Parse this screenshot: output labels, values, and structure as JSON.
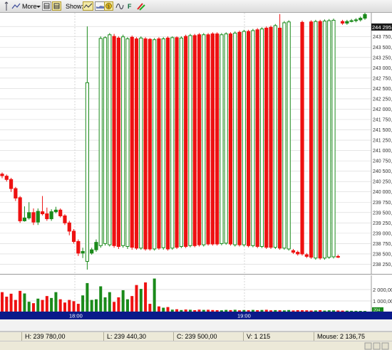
{
  "toolbar": {
    "more_label": "More",
    "show_label": "Show:",
    "f_label": "F",
    "icons": [
      "cursor-icon",
      "line-tool-icon",
      "dropdown-arrow-icon",
      "bar-layout-icon",
      "candle-layout-icon",
      "line-chart-icon",
      "area-chart-icon",
      "indicator-icon",
      "wave-icon",
      "formula-icon",
      "palette-icon"
    ]
  },
  "price_axis": {
    "current_price": "244 295,00",
    "ticks": [
      "244 000,0",
      "243 750,0",
      "243 500,0",
      "243 250,0",
      "243 000,0",
      "242 750,0",
      "242 500,0",
      "242 250,0",
      "242 000,0",
      "241 750,0",
      "241 500,0",
      "241 250,0",
      "241 000,0",
      "240 750,0",
      "240 500,0",
      "240 250,0",
      "240 000,0",
      "239 750,0",
      "239 500,0",
      "239 250,0",
      "239 000,0",
      "238 750,0",
      "238 500,0",
      "238 250,0"
    ],
    "tick_values": [
      244000,
      243750,
      243500,
      243250,
      243000,
      242750,
      242500,
      242250,
      242000,
      241750,
      241500,
      241250,
      241000,
      240750,
      240500,
      240250,
      240000,
      239750,
      239500,
      239250,
      239000,
      238750,
      238500,
      238250
    ]
  },
  "volume_axis": {
    "ticks": [
      "2 000,00",
      "1 000,00"
    ],
    "current_volume": "204"
  },
  "time_axis": {
    "labels": [
      "18:00",
      "19:00"
    ]
  },
  "status": {
    "high": "H: 239 780,00",
    "low": "L: 239 440,30",
    "close": "C: 239 500,00",
    "volume": "V: 1 215",
    "mouse": "Mouse: 2 136,75"
  },
  "colors": {
    "up": "#1a8a1a",
    "down": "#ee1111",
    "background": "#ffffff",
    "grid": "#d6d6d6",
    "axis_band": "#0a1a8a",
    "current_price_bg": "#1a1a1a"
  },
  "chart_data": {
    "type": "candlestick",
    "ylim": [
      238000,
      244330
    ],
    "volume_ylim": [
      0,
      2800
    ],
    "candles": [
      {
        "o": 240430,
        "c": 240390,
        "h": 240470,
        "l": 240330
      },
      {
        "o": 240380,
        "c": 240300,
        "h": 240420,
        "l": 240250
      },
      {
        "o": 240300,
        "c": 240080,
        "h": 240340,
        "l": 240000
      },
      {
        "o": 240080,
        "c": 239850,
        "h": 240120,
        "l": 239780
      },
      {
        "o": 239860,
        "c": 239300,
        "h": 239900,
        "l": 239250
      },
      {
        "o": 239300,
        "c": 239370,
        "h": 239650,
        "l": 239280
      },
      {
        "o": 239370,
        "c": 239500,
        "h": 239750,
        "l": 239330
      },
      {
        "o": 239500,
        "c": 239270,
        "h": 239600,
        "l": 239200
      },
      {
        "o": 239270,
        "c": 239530,
        "h": 239600,
        "l": 239200
      },
      {
        "o": 239520,
        "c": 239470,
        "h": 239900,
        "l": 239430
      },
      {
        "o": 239470,
        "c": 239350,
        "h": 239620,
        "l": 239300
      },
      {
        "o": 239350,
        "c": 239520,
        "h": 239580,
        "l": 239300
      },
      {
        "o": 239520,
        "c": 239560,
        "h": 239640,
        "l": 239480
      },
      {
        "o": 239560,
        "c": 239420,
        "h": 239600,
        "l": 239380
      },
      {
        "o": 239420,
        "c": 239250,
        "h": 239460,
        "l": 239200
      },
      {
        "o": 239250,
        "c": 239050,
        "h": 239300,
        "l": 238950
      },
      {
        "o": 239050,
        "c": 238800,
        "h": 239100,
        "l": 238750
      },
      {
        "o": 238800,
        "c": 238520,
        "h": 238850,
        "l": 238450
      },
      {
        "o": 238520,
        "c": 238560,
        "h": 238650,
        "l": 238400
      },
      {
        "o": 238320,
        "c": 242640,
        "h": 244000,
        "l": 238120
      },
      {
        "o": 238520,
        "c": 238600,
        "h": 238650,
        "l": 238480
      },
      {
        "o": 238600,
        "c": 238780,
        "h": 238850,
        "l": 238550
      },
      {
        "o": 238700,
        "c": 243710,
        "h": 243760,
        "l": 238650
      },
      {
        "o": 238750,
        "c": 243730,
        "h": 243760,
        "l": 238700
      },
      {
        "o": 238720,
        "c": 243800,
        "h": 243840,
        "l": 238680
      },
      {
        "o": 243760,
        "c": 238700,
        "h": 243820,
        "l": 238650
      },
      {
        "o": 243720,
        "c": 238680,
        "h": 243760,
        "l": 238620
      },
      {
        "o": 238700,
        "c": 243750,
        "h": 243800,
        "l": 238650
      },
      {
        "o": 238680,
        "c": 243700,
        "h": 243740,
        "l": 238620
      },
      {
        "o": 243740,
        "c": 238660,
        "h": 243780,
        "l": 238600
      },
      {
        "o": 243700,
        "c": 238640,
        "h": 243740,
        "l": 238600
      },
      {
        "o": 238640,
        "c": 243720,
        "h": 243760,
        "l": 238600
      },
      {
        "o": 243700,
        "c": 238620,
        "h": 243740,
        "l": 238580
      },
      {
        "o": 243690,
        "c": 238620,
        "h": 243720,
        "l": 238580
      },
      {
        "o": 238620,
        "c": 243680,
        "h": 243720,
        "l": 238580
      },
      {
        "o": 243700,
        "c": 238640,
        "h": 243740,
        "l": 238600
      },
      {
        "o": 238650,
        "c": 243700,
        "h": 243740,
        "l": 238600
      },
      {
        "o": 243720,
        "c": 238620,
        "h": 243760,
        "l": 238580
      },
      {
        "o": 238640,
        "c": 243730,
        "h": 243760,
        "l": 238600
      },
      {
        "o": 243730,
        "c": 238660,
        "h": 243760,
        "l": 238620
      },
      {
        "o": 238680,
        "c": 243720,
        "h": 243760,
        "l": 238640
      },
      {
        "o": 243760,
        "c": 238680,
        "h": 243800,
        "l": 238640
      },
      {
        "o": 238700,
        "c": 243780,
        "h": 243820,
        "l": 238660
      },
      {
        "o": 243780,
        "c": 238700,
        "h": 243820,
        "l": 238660
      },
      {
        "o": 243800,
        "c": 238720,
        "h": 243840,
        "l": 238680
      },
      {
        "o": 238720,
        "c": 243800,
        "h": 243840,
        "l": 238680
      },
      {
        "o": 243800,
        "c": 238740,
        "h": 243840,
        "l": 238700
      },
      {
        "o": 243820,
        "c": 238740,
        "h": 243860,
        "l": 238700
      },
      {
        "o": 243820,
        "c": 238740,
        "h": 243860,
        "l": 238700
      },
      {
        "o": 238750,
        "c": 243800,
        "h": 243840,
        "l": 238710
      },
      {
        "o": 238760,
        "c": 243820,
        "h": 243860,
        "l": 238720
      },
      {
        "o": 243820,
        "c": 238740,
        "h": 243860,
        "l": 238700
      },
      {
        "o": 238720,
        "c": 243840,
        "h": 243880,
        "l": 238680
      },
      {
        "o": 243860,
        "c": 238720,
        "h": 243900,
        "l": 238680
      },
      {
        "o": 238720,
        "c": 243880,
        "h": 243920,
        "l": 238680
      },
      {
        "o": 243880,
        "c": 238700,
        "h": 243920,
        "l": 238660
      },
      {
        "o": 238700,
        "c": 243900,
        "h": 243940,
        "l": 238660
      },
      {
        "o": 243920,
        "c": 238680,
        "h": 243960,
        "l": 238640
      },
      {
        "o": 238680,
        "c": 243940,
        "h": 243980,
        "l": 238640
      },
      {
        "o": 243960,
        "c": 238660,
        "h": 244000,
        "l": 238620
      },
      {
        "o": 243980,
        "c": 238660,
        "h": 244020,
        "l": 238620
      },
      {
        "o": 238660,
        "c": 244020,
        "h": 244060,
        "l": 238620
      },
      {
        "o": 243960,
        "c": 238640,
        "h": 244300,
        "l": 238600
      },
      {
        "o": 238640,
        "c": 244090,
        "h": 244130,
        "l": 238600
      },
      {
        "o": 238620,
        "c": 244110,
        "h": 244150,
        "l": 238580
      },
      {
        "o": 238580,
        "c": 238540,
        "h": 238620,
        "l": 238500
      },
      {
        "o": 238540,
        "c": 238500,
        "h": 238580,
        "l": 238460
      },
      {
        "o": 244100,
        "c": 238500,
        "h": 244140,
        "l": 238460
      },
      {
        "o": 238480,
        "c": 238440,
        "h": 238520,
        "l": 238400
      },
      {
        "o": 244110,
        "c": 238420,
        "h": 244150,
        "l": 238380
      },
      {
        "o": 238400,
        "c": 244120,
        "h": 244160,
        "l": 238360
      },
      {
        "o": 244120,
        "c": 238400,
        "h": 244160,
        "l": 238360
      },
      {
        "o": 238400,
        "c": 244130,
        "h": 244170,
        "l": 238360
      },
      {
        "o": 238420,
        "c": 244140,
        "h": 244180,
        "l": 238380
      },
      {
        "o": 238430,
        "c": 244150,
        "h": 244190,
        "l": 238390
      },
      {
        "o": 238440,
        "c": 238420,
        "h": 238480,
        "l": 238400
      },
      {
        "o": 244120,
        "c": 244080,
        "h": 244160,
        "l": 244040
      },
      {
        "o": 244080,
        "c": 244120,
        "h": 244160,
        "l": 244040
      },
      {
        "o": 244120,
        "c": 244140,
        "h": 244180,
        "l": 244100
      },
      {
        "o": 244140,
        "c": 244160,
        "h": 244200,
        "l": 244100
      },
      {
        "o": 244160,
        "c": 244200,
        "h": 244240,
        "l": 244120
      },
      {
        "o": 244200,
        "c": 244290,
        "h": 244330,
        "l": 244160
      }
    ],
    "volumes": [
      1500,
      1150,
      1380,
      900,
      1600,
      1400,
      760,
      650,
      1000,
      900,
      1200,
      1050,
      1500,
      950,
      700,
      900,
      800,
      600,
      1250,
      2200,
      900,
      950,
      1950,
      1100,
      1500,
      750,
      1100,
      1650,
      950,
      1200,
      2050,
      1750,
      2250,
      600,
      2550,
      400,
      300,
      350,
      150,
      180,
      120,
      160,
      140,
      110,
      150,
      130,
      140,
      120,
      110,
      100,
      130,
      115,
      140,
      100,
      120,
      105,
      130,
      110,
      125,
      140,
      100,
      115,
      105,
      95,
      120,
      90,
      110,
      105,
      100,
      85,
      90,
      110,
      80,
      100,
      95,
      85,
      75,
      70,
      65,
      60,
      55,
      50
    ],
    "xlabel": "",
    "ylabel": ""
  }
}
